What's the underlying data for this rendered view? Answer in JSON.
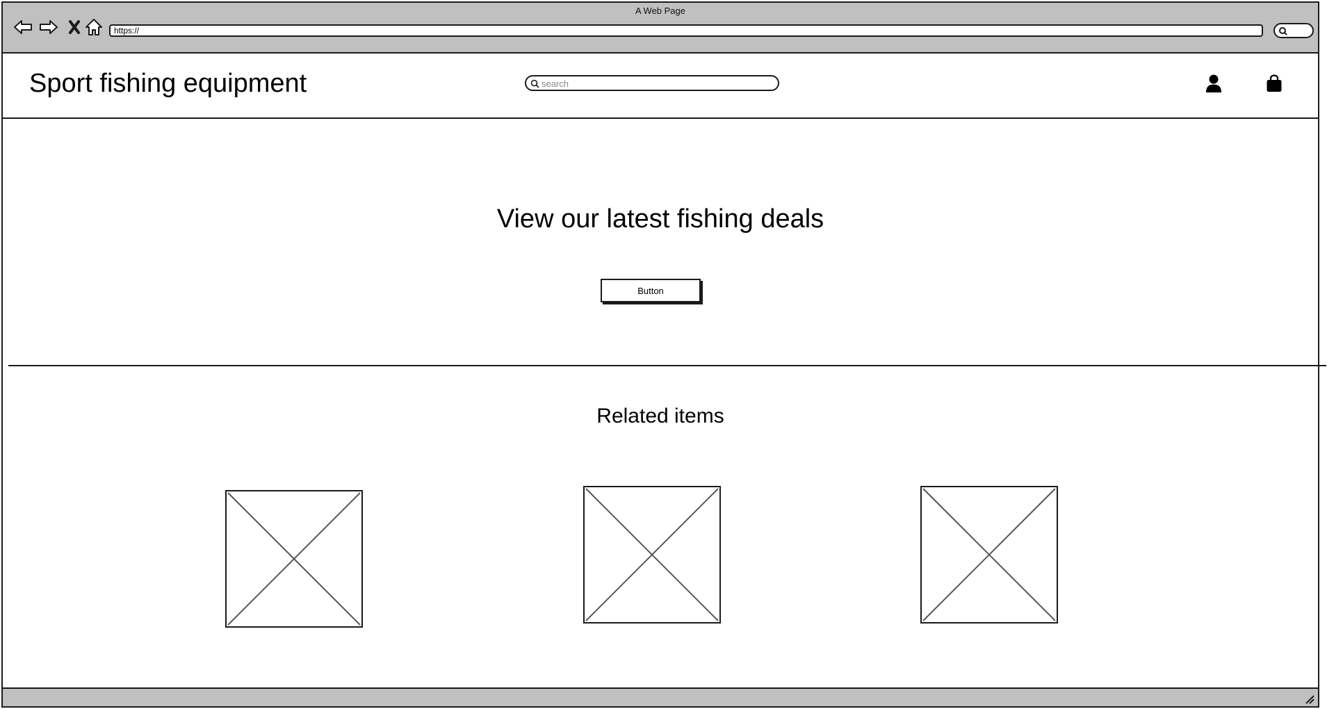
{
  "window": {
    "title": "A Web Page",
    "url": "https://"
  },
  "toolbar": {
    "icons": [
      "back-arrow-icon",
      "forward-arrow-icon",
      "close-x-icon",
      "home-icon",
      "search-icon"
    ]
  },
  "header": {
    "site_title": "Sport fishing equipment",
    "search_placeholder": "search",
    "icons": [
      "user-icon",
      "shopping-bag-icon"
    ]
  },
  "hero": {
    "title": "View our latest fishing deals",
    "button_label": "Button"
  },
  "related": {
    "title": "Related items",
    "items": [
      {
        "type": "image-placeholder"
      },
      {
        "type": "image-placeholder"
      },
      {
        "type": "image-placeholder"
      }
    ]
  },
  "colors": {
    "chrome": "#c0c0c0",
    "stroke": "#1a1a1a",
    "background": "#ffffff"
  }
}
